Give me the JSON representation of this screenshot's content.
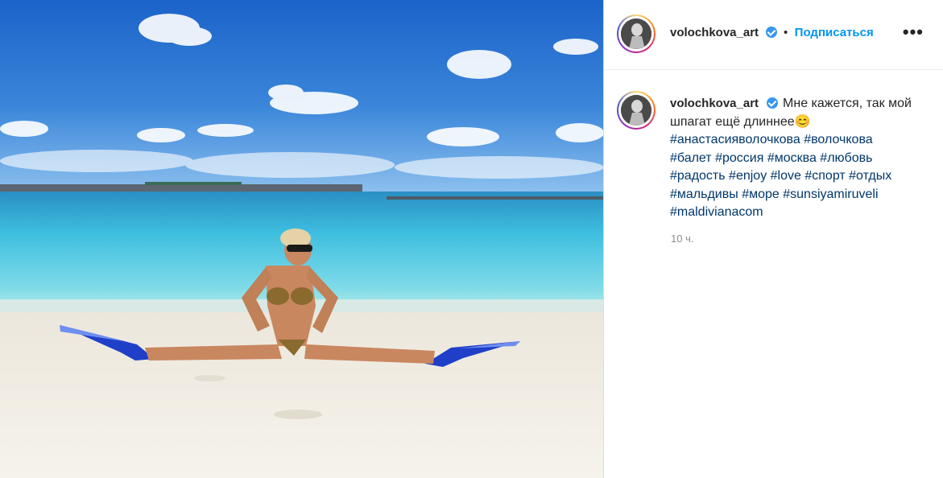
{
  "post": {
    "username": "volochkova_art",
    "follow_label": "Подписаться",
    "separator": "•",
    "more_label": "•••",
    "caption_text": "Мне кажется, так мой шпагат ещё длиннее😊",
    "hashtags": [
      "#анастасияволочкова",
      "#волочкова",
      "#балет",
      "#россия",
      "#москва",
      "#любовь",
      "#радость",
      "#enjoy",
      "#love",
      "#спорт",
      "#отдых",
      "#мальдивы",
      "#море",
      "#sunsiyamiruveli",
      "#maldivianacom"
    ],
    "time": "10 ч."
  },
  "colors": {
    "accent": "#0095f6",
    "verified": "#3897f0",
    "hashtag": "#00376b",
    "muted": "#8e8e8e"
  },
  "photo": {
    "subject": "woman doing a split on a white sand beach wearing blue swim fins, turquoise sea and blue sky with clouds"
  }
}
